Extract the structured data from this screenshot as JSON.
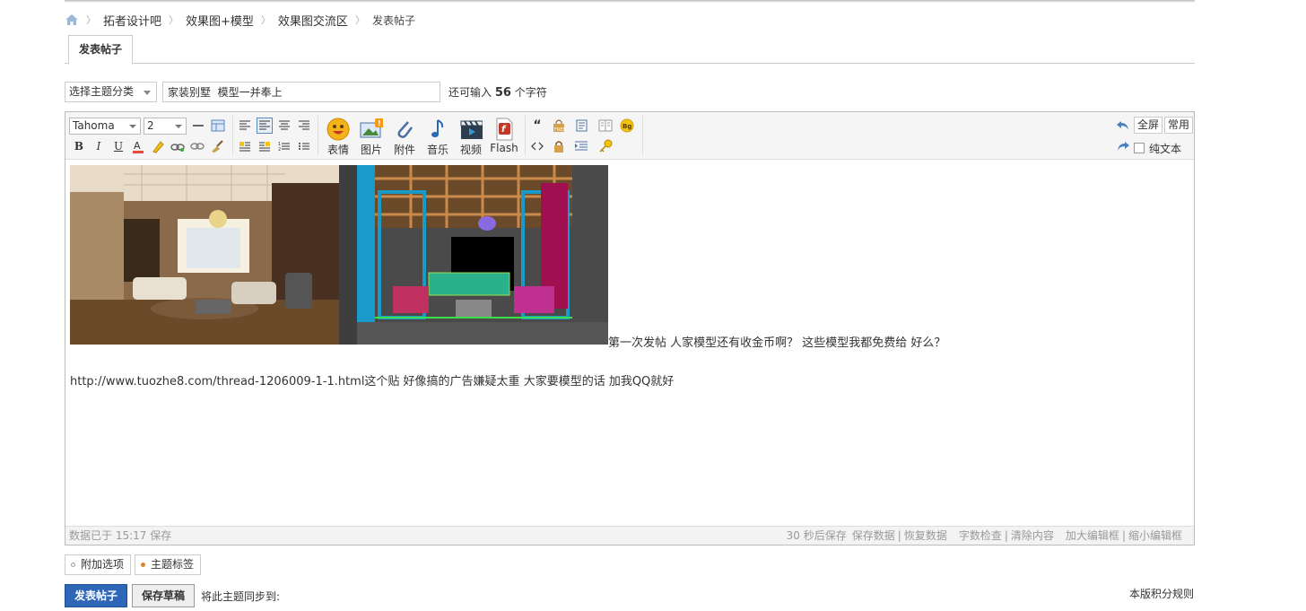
{
  "breadcrumb": {
    "items": [
      "拓者设计吧",
      "效果图+模型",
      "效果图交流区"
    ],
    "current": "发表帖子"
  },
  "tab": {
    "label": "发表帖子"
  },
  "form": {
    "category_select": "选择主题分类",
    "subject_value": "家装别墅  模型一并奉上",
    "remain_prefix": "还可输入",
    "remain_count": "56",
    "remain_suffix": "个字符"
  },
  "toolbar": {
    "font_family": "Tahoma",
    "font_size": "2",
    "emoji_label": "表情",
    "image_label": "图片",
    "attach_label": "附件",
    "music_label": "音乐",
    "video_label": "视频",
    "flash_label": "Flash",
    "fullscreen_label": "全屏",
    "common_label": "常用",
    "plaintext_label": "纯文本",
    "image_badge": "!"
  },
  "content": {
    "line1": "第一次发帖  人家模型还有收金币啊？ 这些模型我都免费给 好么？",
    "line2": "http://www.tuozhe8.com/thread-1206009-1-1.html这个贴 好像搞的广告嫌疑太重  大家要模型的话 加我QQ就好"
  },
  "status": {
    "saved": "数据已于 15:17 保存",
    "autosave": "30 秒后保存",
    "save_data": "保存数据",
    "restore_data": "恢复数据",
    "word_check": "字数检查",
    "clear_content": "清除内容",
    "enlarge": "加大编辑框",
    "shrink": "缩小编辑框"
  },
  "options": {
    "extra_label": "附加选项",
    "tags_label": "主题标签"
  },
  "actions": {
    "post_label": "发表帖子",
    "draft_label": "保存草稿",
    "sync_label": "将此主题同步到:",
    "rules_label": "本版积分规则"
  },
  "colors": {
    "accent": "#2e67b7",
    "tag_dot": "#e67e22"
  }
}
